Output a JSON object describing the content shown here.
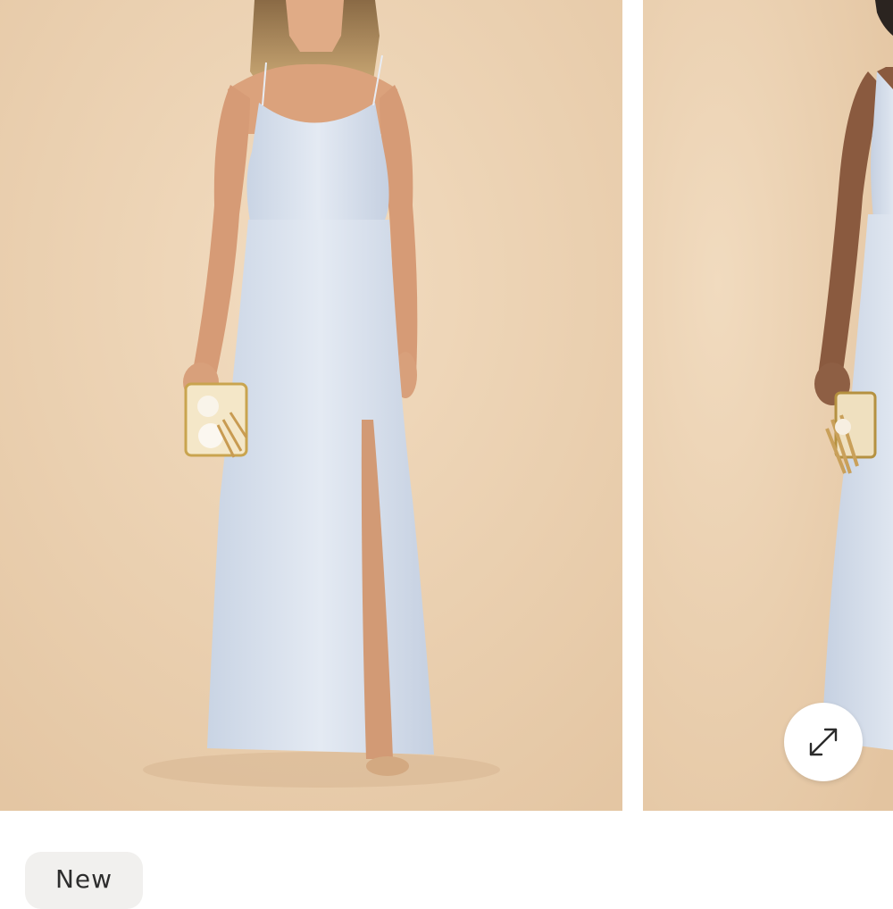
{
  "gallery": {
    "slides": [
      {
        "image": "model-in-light-blue-maxi-dress-front"
      },
      {
        "image": "model-in-light-blue-maxi-dress-side"
      }
    ],
    "expand_button": {
      "icon": "expand-arrows-icon"
    }
  },
  "badge": {
    "label": "New"
  },
  "colors": {
    "backdrop": "#e8cfb0",
    "dress": "#dbe3ee",
    "skin": "#d9a07c",
    "badge_bg": "#f1f0ee",
    "icon": "#2b2b2b"
  }
}
